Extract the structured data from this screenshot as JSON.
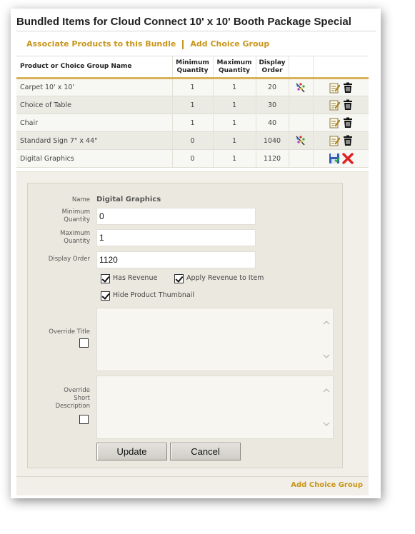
{
  "page": {
    "title": "Bundled Items for Cloud Connect 10' x 10' Booth Package Special"
  },
  "links": {
    "associate": "Associate Products to this Bundle",
    "add_choice_group": "Add Choice Group"
  },
  "table": {
    "headers": {
      "name": "Product or Choice Group Name",
      "min_line1": "Minimum",
      "min_line2": "Quantity",
      "max_line1": "Maximum",
      "max_line2": "Quantity",
      "order_line1": "Display",
      "order_line2": "Order"
    },
    "rows": [
      {
        "name": "Carpet 10' x 10'",
        "min": "1",
        "max": "1",
        "order": "20"
      },
      {
        "name": "Choice of Table",
        "min": "1",
        "max": "1",
        "order": "30"
      },
      {
        "name": "Chair",
        "min": "1",
        "max": "1",
        "order": "40"
      },
      {
        "name": "Standard Sign 7\" x 44\"",
        "min": "0",
        "max": "1",
        "order": "1040"
      },
      {
        "name": "Digital Graphics",
        "min": "0",
        "max": "1",
        "order": "1120"
      }
    ]
  },
  "form": {
    "name_label": "Name",
    "name_value": "Digital Graphics",
    "min_label_1": "Minimum",
    "min_label_2": "Quantity",
    "min_value": "0",
    "max_label_1": "Maximum",
    "max_label_2": "Quantity",
    "max_value": "1",
    "order_label": "Display Order",
    "order_value": "1120",
    "has_revenue": "Has Revenue",
    "apply_revenue": "Apply Revenue to Item",
    "hide_thumbnail": "Hide Product Thumbnail",
    "override_title": "Override Title",
    "override_desc_1": "Override",
    "override_desc_2": "Short",
    "override_desc_3": "Description",
    "update_button": "Update",
    "cancel_button": "Cancel"
  },
  "footer": {
    "add_choice_group": "Add Choice Group"
  },
  "colors": {
    "link": "#c8961c",
    "header_rule": "#d9b25a",
    "delete_red": "#e02020"
  }
}
